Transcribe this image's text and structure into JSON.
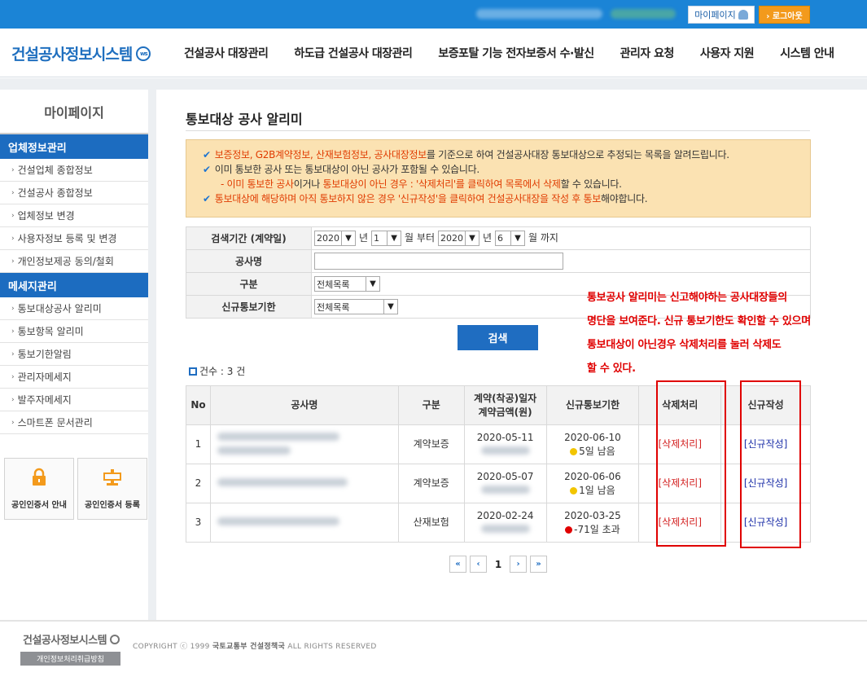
{
  "topbar": {
    "mypage_label": "마이페이지",
    "logout_label": "› 로그아웃"
  },
  "header": {
    "logo_text": "건설공사정보시스템",
    "logo_mark": "ws",
    "nav": [
      "건설공사 대장관리",
      "하도급 건설공사 대장관리",
      "보증포탈 기능 전자보증서 수·발신",
      "관리자 요청",
      "사용자 지원",
      "시스템 안내"
    ]
  },
  "sidebar": {
    "title": "마이페이지",
    "group1": {
      "title": "업체정보관리",
      "items": [
        "건설업체 종합정보",
        "건설공사 종합정보",
        "업체정보 변경",
        "사용자정보 등록 및 변경",
        "개인정보제공 동의/철회"
      ]
    },
    "group2": {
      "title": "메세지관리",
      "items": [
        "통보대상공사 알리미",
        "통보항목 알리미",
        "통보기한알림",
        "관리자메세지",
        "발주자메세지",
        "스마트폰 문서관리"
      ]
    },
    "cert1": "공인인증서 안내",
    "cert2": "공인인증서 등록"
  },
  "main": {
    "title": "통보대상 공사 알리미",
    "notice": {
      "l1a": "보증정보, G2B계약정보, 산재보험정보, 공사대장정보",
      "l1b": "를 기준으로 하여 건설공사대장 통보대상으로 추정되는 목록을 알려드립니다.",
      "l2": "이미 통보한 공사 또는 통보대상이 아닌 공사가 포함될 수 있습니다.",
      "l3a": "- 이미 통보한 공사",
      "l3b": "이거나 ",
      "l3c": "통보대상이 아닌 경우 : '삭제처리'를 클릭하여 목록에서 삭제",
      "l3d": "할 수 있습니다.",
      "l4a": "통보대상에 해당하며 아직 통보하지 않은 경우 '신규작성'을 클릭하여 건설공사대장을 작성 후 통보",
      "l4b": "해야합니다."
    },
    "search": {
      "period_label": "검색기간 (계약일)",
      "from_year": "2020",
      "year_unit": "년",
      "from_month": "1",
      "month_from": "월 부터",
      "to_year": "2020",
      "to_month": "6",
      "month_to": "월 까지",
      "name_label": "공사명",
      "name_value": "",
      "type_label": "구분",
      "type_value": "전체목록",
      "deadline_label": "신규통보기한",
      "deadline_value": "전체목록",
      "button": "검색"
    },
    "count_label": "건수 : 3 건",
    "table": {
      "headers": {
        "no": "No",
        "name": "공사명",
        "type": "구분",
        "date1": "계약(착공)일자",
        "date2": "계약금액(원)",
        "deadline": "신규통보기한",
        "delete": "삭제처리",
        "new": "신규작성"
      },
      "rows": [
        {
          "no": "1",
          "type": "계약보증",
          "date": "2020-05-11",
          "deadline": "2020-06-10",
          "remain": "5일 남음",
          "status_color": "#f2c500",
          "delete": "[삭제처리]",
          "new": "[신규작성]"
        },
        {
          "no": "2",
          "type": "계약보증",
          "date": "2020-05-07",
          "deadline": "2020-06-06",
          "remain": "1일 남음",
          "status_color": "#f2c500",
          "delete": "[삭제처리]",
          "new": "[신규작성]"
        },
        {
          "no": "3",
          "type": "산재보험",
          "date": "2020-02-24",
          "deadline": "2020-03-25",
          "remain": "-71일 초과",
          "status_color": "#e00000",
          "delete": "[삭제처리]",
          "new": "[신규작성]"
        }
      ]
    },
    "annotation": [
      "통보공사 알리미는 신고해야하는 공사대장들의",
      "명단을 보여준다. 신규 통보기한도 확인할 수 있으며",
      "통보대상이 아닌경우 삭제처리를 눌러 삭제도",
      "할 수 있다."
    ],
    "pager": {
      "first": "«",
      "prev": "‹",
      "page": "1",
      "next": "›",
      "last": "»"
    }
  },
  "footer": {
    "logo": "건설공사정보시스템",
    "privacy": "개인정보처리취급방침",
    "copy1": "COPYRIGHT ⓒ 1999 ",
    "copy2": "국토교통부 건설정책국",
    "copy3": " ALL RIGHTS RESERVED"
  }
}
